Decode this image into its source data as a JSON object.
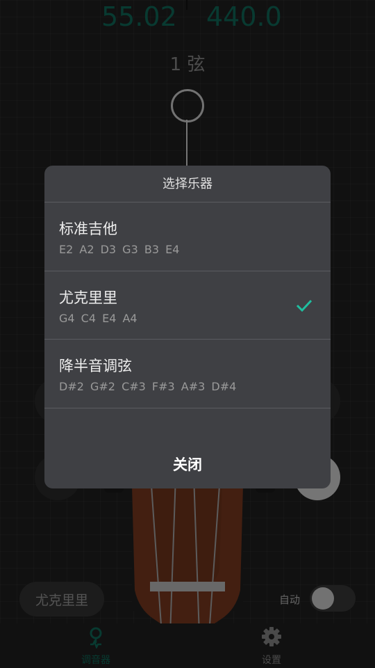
{
  "tuner": {
    "freq_left": "55.02",
    "freq_right": "440.0",
    "string_label": "1 弦"
  },
  "instrument_pill": "尤克里里",
  "auto": {
    "label": "自动",
    "enabled": false
  },
  "nav": {
    "tuner_label": "调音器",
    "tuner_icon": "tuner-pin-icon",
    "settings_label": "设置",
    "settings_icon": "gear-icon"
  },
  "dialog": {
    "title": "选择乐器",
    "options": [
      {
        "name": "标准吉他",
        "notes": "E2 A2 D3 G3 B3 E4",
        "selected": false
      },
      {
        "name": "尤克里里",
        "notes": "G4 C4 E4 A4",
        "selected": true
      },
      {
        "name": "降半音调弦",
        "notes": "D#2 G#2 C#3 F#3 A#3 D#4",
        "selected": false
      }
    ],
    "close_label": "关闭"
  },
  "colors": {
    "accent": "#1fbfa0",
    "frequency": "#0f6b5a",
    "dialog_bg": "#3f4044",
    "headstock": "#7a3a20"
  }
}
